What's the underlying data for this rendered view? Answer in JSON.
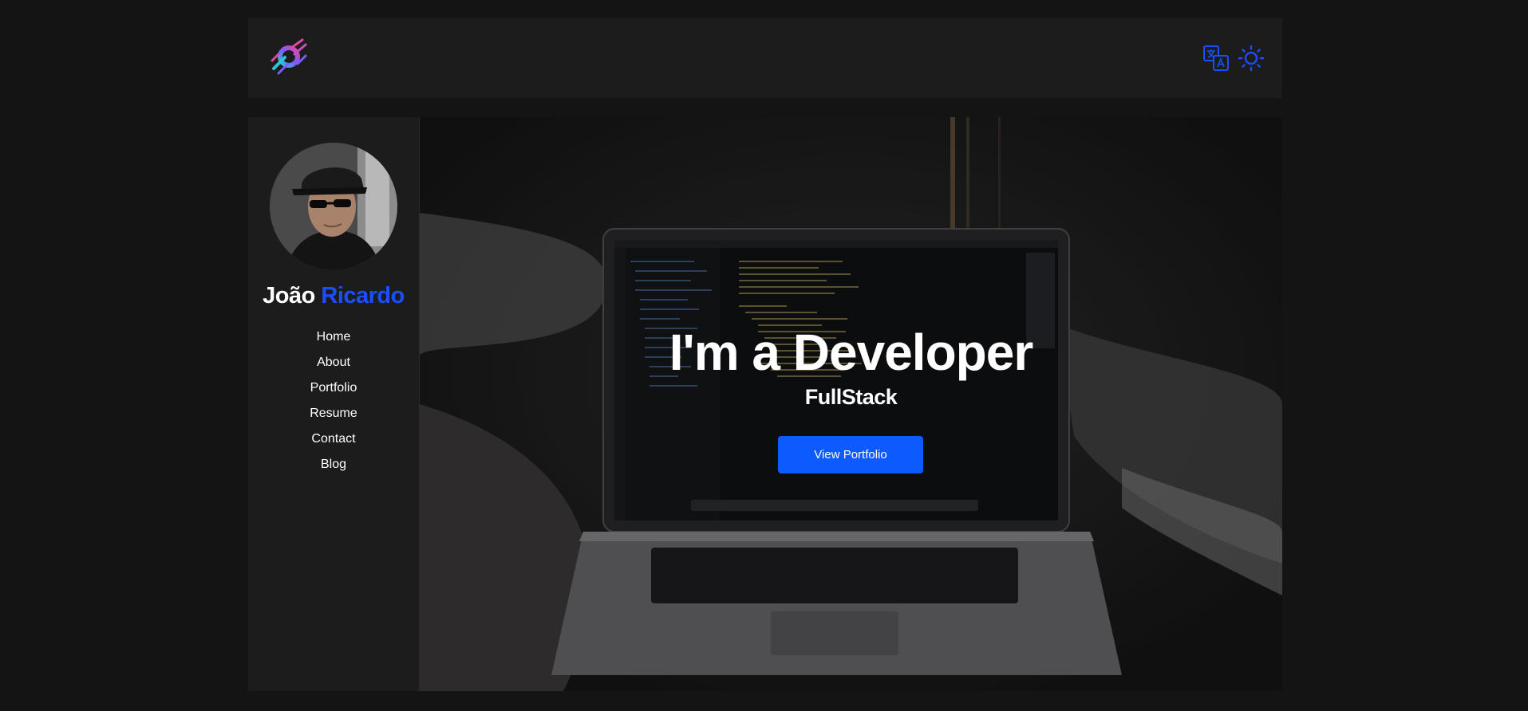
{
  "header": {
    "logo_icon": "abstract-swirl-logo",
    "translate_icon": "translate-icon",
    "theme_icon": "sun-icon"
  },
  "sidebar": {
    "name_first": "João",
    "name_last": "Ricardo",
    "avatar_icon": "profile-photo",
    "nav": [
      {
        "label": "Home"
      },
      {
        "label": "About"
      },
      {
        "label": "Portfolio"
      },
      {
        "label": "Resume"
      },
      {
        "label": "Contact"
      },
      {
        "label": "Blog"
      }
    ]
  },
  "hero": {
    "title": "I'm a Developer",
    "subtitle": "FullStack",
    "button_label": "View Portfolio"
  },
  "colors": {
    "accent": "#1a4fff",
    "button": "#0d5bff",
    "background": "#141414",
    "panel": "#1c1c1c"
  }
}
